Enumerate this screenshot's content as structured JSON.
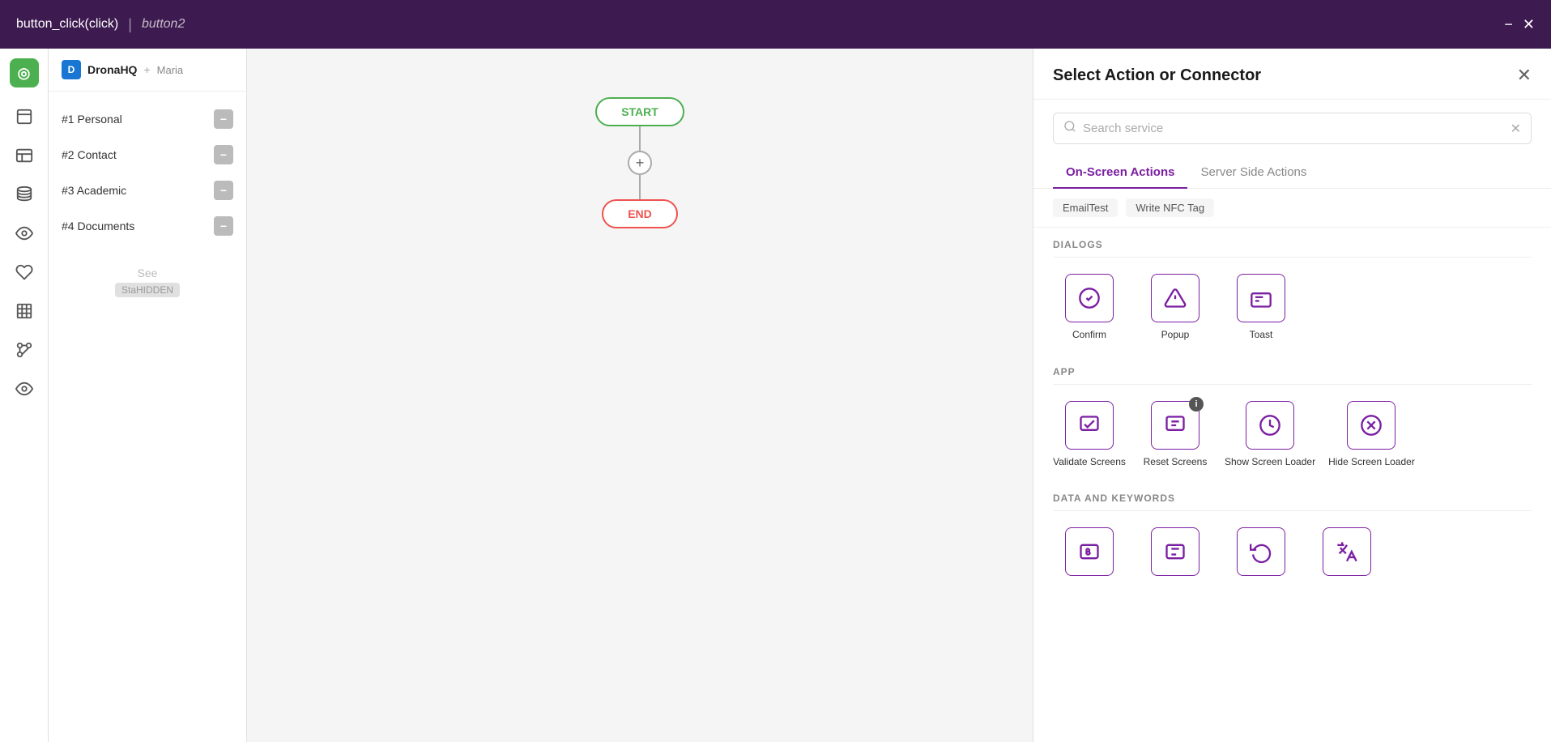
{
  "topBar": {
    "functionName": "button_click(click)",
    "separator": "|",
    "buttonName": "button2",
    "minimizeLabel": "−",
    "closeLabel": "✕"
  },
  "iconSidebar": {
    "logo": "◎",
    "items": [
      {
        "name": "page-icon",
        "icon": "⬜"
      },
      {
        "name": "layout-icon",
        "icon": "▭"
      },
      {
        "name": "database-icon",
        "icon": "🗄"
      },
      {
        "name": "eye-icon",
        "icon": "👁"
      },
      {
        "name": "plugin-icon",
        "icon": "🔌"
      },
      {
        "name": "table-icon",
        "icon": "⊞"
      },
      {
        "name": "components-icon",
        "icon": "⊕"
      },
      {
        "name": "preview-icon",
        "icon": "👁"
      }
    ]
  },
  "leftPanel": {
    "logo": "D",
    "title": "DronaHQ",
    "plus": "+",
    "brand": "Maria",
    "items": [
      {
        "label": "#1 Personal",
        "badge": "−"
      },
      {
        "label": "#2 Contact",
        "badge": "−"
      },
      {
        "label": "#3 Academic",
        "badge": "−"
      },
      {
        "label": "#4 Documents",
        "badge": "−"
      }
    ],
    "seeMoreText": "See",
    "hiddenLabel": "StaHIDDEN"
  },
  "canvas": {
    "startLabel": "START",
    "endLabel": "END",
    "addButtonLabel": "+"
  },
  "rightPanel": {
    "title": "Select Action or Connector",
    "closeLabel": "✕",
    "search": {
      "placeholder": "Search service",
      "clearLabel": "✕"
    },
    "tabs": [
      {
        "label": "On-Screen Actions",
        "active": true
      },
      {
        "label": "Server Side Actions",
        "active": false
      }
    ],
    "quickFilters": [
      {
        "label": "EmailTest"
      },
      {
        "label": "Write NFC Tag"
      }
    ],
    "sections": [
      {
        "name": "DIALOGS",
        "items": [
          {
            "label": "Confirm",
            "icon": "confirm"
          },
          {
            "label": "Popup",
            "icon": "popup"
          },
          {
            "label": "Toast",
            "icon": "toast"
          }
        ]
      },
      {
        "name": "APP",
        "items": [
          {
            "label": "Validate Screens",
            "icon": "validate",
            "badge": null
          },
          {
            "label": "Reset Screens",
            "icon": "reset",
            "badge": "i"
          },
          {
            "label": "Show Screen Loader",
            "icon": "show-loader",
            "badge": null
          },
          {
            "label": "Hide Screen Loader",
            "icon": "hide-loader",
            "badge": null
          }
        ]
      },
      {
        "name": "DATA AND KEYWORDS",
        "items": [
          {
            "label": "",
            "icon": "variable1"
          },
          {
            "label": "",
            "icon": "variable2"
          },
          {
            "label": "",
            "icon": "rotate"
          },
          {
            "label": "",
            "icon": "translate"
          }
        ]
      }
    ]
  }
}
